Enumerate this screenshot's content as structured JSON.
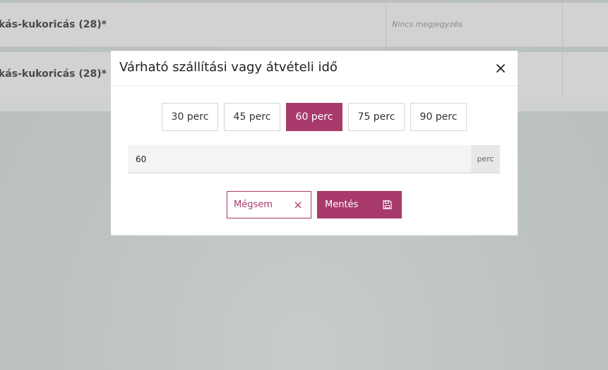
{
  "background": {
    "rows": [
      {
        "name": "kás-kukoricás (28)*",
        "note": "Nincs megjegyzés"
      },
      {
        "name": "kás-kukoricás (28)*",
        "note": ""
      }
    ]
  },
  "modal": {
    "title": "Várható szállítási vagy átvételi idő",
    "close_icon": "close-icon",
    "presets": [
      "30 perc",
      "45 perc",
      "60 perc",
      "75 perc",
      "90 perc"
    ],
    "active_preset": "60 perc",
    "time_value": "60",
    "unit": "perc",
    "cancel_label": "Mégsem",
    "cancel_icon": "x-icon",
    "save_label": "Mentés",
    "save_icon": "save-icon"
  },
  "colors": {
    "accent": "#a83a6c",
    "overlay_background": "#bcc1c1",
    "input_background": "#f3f4f4"
  }
}
